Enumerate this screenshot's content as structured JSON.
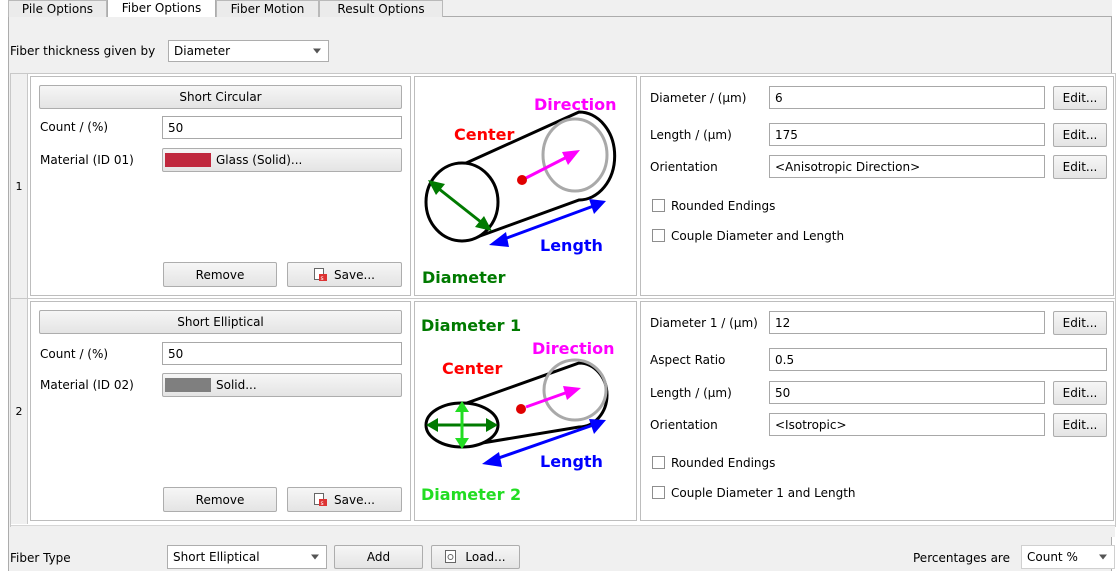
{
  "tabs": [
    "Pile Options",
    "Fiber Options",
    "Fiber Motion",
    "Result Options"
  ],
  "thickness": {
    "label": "Fiber thickness given by",
    "value": "Diameter"
  },
  "fibers": [
    {
      "row": "1",
      "title": "Short Circular",
      "count_label": "Count / (%)",
      "count": "50",
      "material_label": "Material (ID 01)",
      "material": "Glass (Solid)...",
      "material_color": "#c0283e",
      "remove": "Remove",
      "save": "Save...",
      "diagram": {
        "direction": "Direction",
        "center": "Center",
        "length": "Length",
        "diameter": "Diameter"
      },
      "props": {
        "p1_label": "Diameter / (µm)",
        "p1_value": "6",
        "p2_label": "Length / (µm)",
        "p2_value": "175",
        "p3_label": "Orientation",
        "p3_value": "<Anisotropic Direction>",
        "edit": "Edit...",
        "check1": "Rounded Endings",
        "check2": "Couple Diameter and Length"
      }
    },
    {
      "row": "2",
      "title": "Short Elliptical",
      "count_label": "Count / (%)",
      "count": "50",
      "material_label": "Material (ID 02)",
      "material": "Solid...",
      "material_color": "#7f7f7f",
      "remove": "Remove",
      "save": "Save...",
      "diagram": {
        "diameter1": "Diameter 1",
        "direction": "Direction",
        "center": "Center",
        "length": "Length",
        "diameter2": "Diameter 2"
      },
      "props": {
        "p1_label": "Diameter 1 / (µm)",
        "p1_value": "12",
        "p2_label": "Aspect Ratio",
        "p2_value": "0.5",
        "p3_label": "Length / (µm)",
        "p3_value": "50",
        "p4_label": "Orientation",
        "p4_value": "<Isotropic>",
        "edit": "Edit...",
        "check1": "Rounded Endings",
        "check2": "Couple Diameter 1 and Length"
      }
    }
  ],
  "bottom": {
    "fiber_type_label": "Fiber Type",
    "fiber_type_value": "Short Elliptical",
    "add": "Add",
    "load": "Load...",
    "percent_label": "Percentages are",
    "percent_value": "Count %"
  },
  "colors": {
    "direction": "#ff00ff",
    "center": "#ff0000",
    "length": "#0000ff",
    "diameter": "#007a00",
    "diameter2": "#22dd22"
  }
}
